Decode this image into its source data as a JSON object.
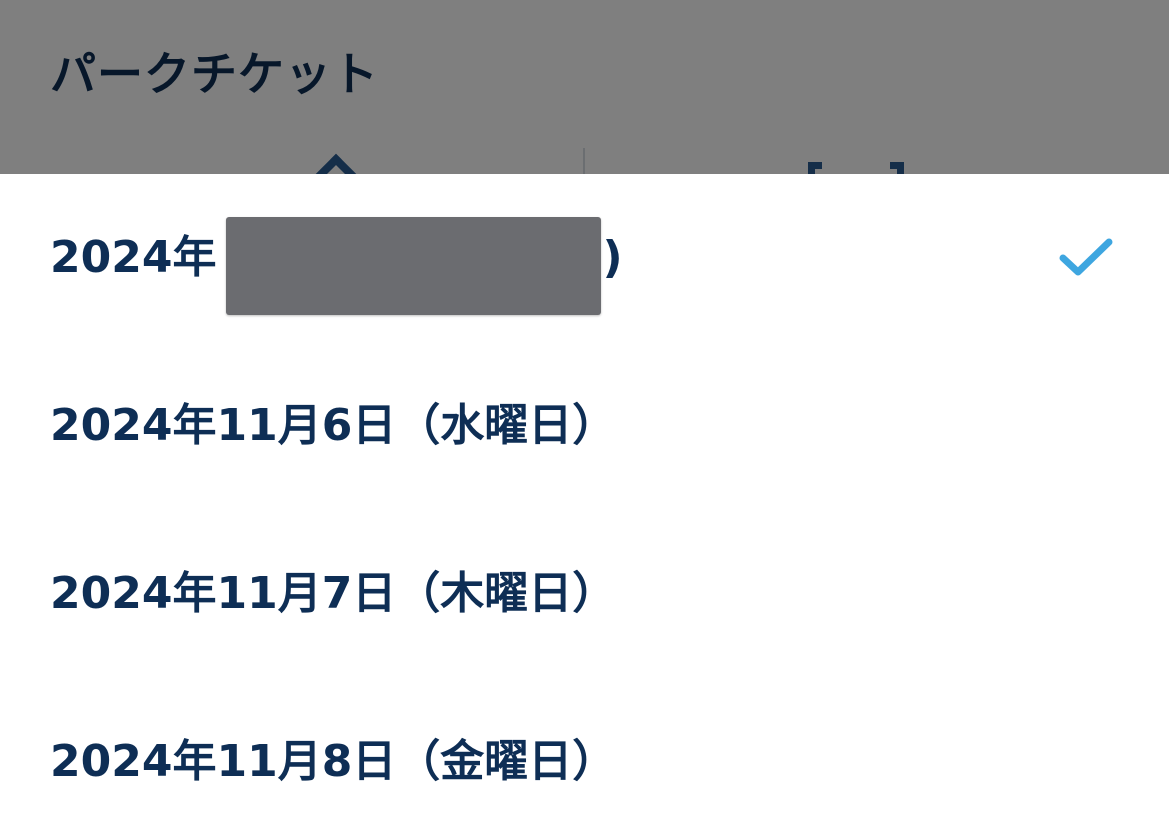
{
  "page": {
    "title": "パークチケット"
  },
  "date_picker": {
    "options": [
      {
        "label": "2024年",
        "tail": ")",
        "selected": true
      },
      {
        "label": "2024年11月6日（水曜日）",
        "selected": false
      },
      {
        "label": "2024年11月7日（木曜日）",
        "selected": false
      },
      {
        "label": "2024年11月8日（金曜日）",
        "selected": false
      }
    ]
  },
  "colors": {
    "text_primary": "#0e2e55",
    "check_accent": "#3ea6e0",
    "overlay": "#000000",
    "redaction": "#6b6c70"
  },
  "icons": {
    "selected_indicator": "checkmark-icon"
  }
}
